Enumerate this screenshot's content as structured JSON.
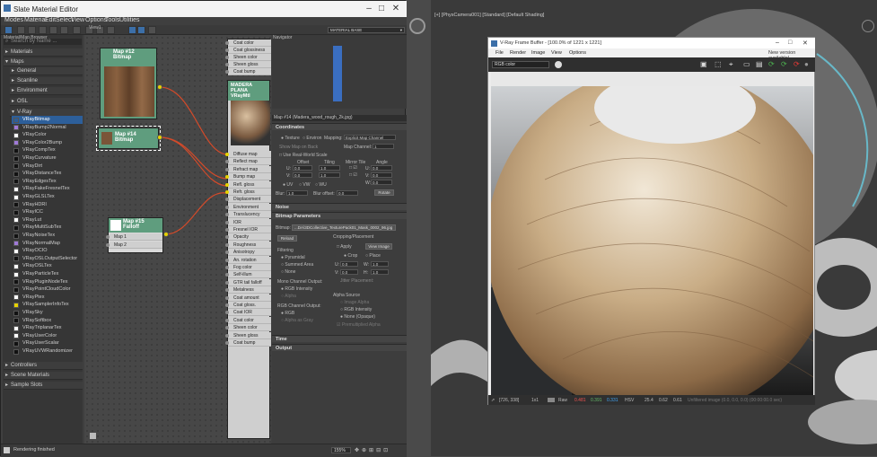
{
  "sme": {
    "title": "Slate Material Editor",
    "menu": [
      "Modes",
      "Material",
      "Edit",
      "Select",
      "View",
      "Options",
      "Tools",
      "Utilities"
    ],
    "browser_label": "Material/Map Browser",
    "search_placeholder": "Search by Name ...",
    "categories": {
      "materials": "Materials",
      "maps": "Maps",
      "general": "General",
      "scanline": "Scanline",
      "environment": "Environment",
      "osl": "OSL",
      "vray": "V-Ray",
      "controllers": "Controllers",
      "scene_materials": "Scene Materials",
      "sample_slots": "Sample Slots"
    },
    "vray_maps": [
      "VRayBitmap",
      "VRayBump2Normal",
      "VRayColor",
      "VRayColor2Bump",
      "VRayCompTex",
      "VRayCurvature",
      "VRayDirt",
      "VRayDistanceTex",
      "VRayEdgesTex",
      "VRayFakeFresnelTex",
      "VRayGLSLTex",
      "VRayHDRI",
      "VRayICC",
      "VRayLut",
      "VRayMultiSubTex",
      "VRayNoiseTex",
      "VRayNormalMap",
      "VRayOCIO",
      "VRayOSLOutputSelector",
      "VRayOSLTex",
      "VRayParticleTex",
      "VRayPluginNodeTex",
      "VRayPointCloudColor",
      "VRayPtex",
      "VRaySamplerInfoTex",
      "VRaySky",
      "VRaySoftbox",
      "VRayTriplanarTex",
      "VRayUserColor",
      "VRayUserScalar",
      "VRayUVWRandomizer"
    ],
    "view_label": "View1",
    "navigator_label": "Navigator",
    "material_dropdown": "MATERIAL BASE",
    "nodes": {
      "map12": {
        "name": "Map #12",
        "type": "Bitmap"
      },
      "map14": {
        "name": "Map #14",
        "type": "Bitmap"
      },
      "map15": {
        "name": "Map #15",
        "type": "Falloff",
        "slots": [
          "Map 1",
          "Map 2"
        ]
      },
      "material": {
        "name": "MADERA PLANA",
        "type": "VRayMtl",
        "slots_top": [
          "Coat color",
          "Coat glossiness",
          "Sheen color",
          "Sheen gloss",
          "Coat bump"
        ],
        "slots": [
          "Diffuse map",
          "Reflect map",
          "Refract map",
          "Bump map",
          "Refl. gloss",
          "Refr. gloss",
          "Displacement",
          "Environment",
          "Translucency",
          "IOR",
          "Fresnel IOR",
          "Opacity",
          "Roughness",
          "Anisotropy",
          "An. rotation",
          "Fog color",
          "Self-illum",
          "GTR tail falloff",
          "Metalness",
          "Coat amount",
          "Coat gloss.",
          "Coat IOR",
          "Coat color",
          "Sheen color",
          "Sheen gloss",
          "Coat bump"
        ]
      }
    },
    "param_title": "Map #14 (Madera_wood_rough_2k.jpg)",
    "rollouts": {
      "coordinates": "Coordinates",
      "noise": "Noise",
      "bitmap_params": "Bitmap Parameters",
      "time": "Time",
      "output": "Output"
    },
    "coords": {
      "texture": "Texture",
      "environ": "Environ",
      "mapping_label": "Mapping:",
      "mapping_value": "Explicit Map Channel",
      "show_map": "Show Map on Back",
      "map_channel_label": "Map Channel:",
      "map_channel": "1",
      "real_world": "Use Real-World Scale",
      "offset": "Offset",
      "tiling": "Tiling",
      "mirror_tile": "Mirror Tile",
      "angle": "Angle",
      "u_label": "U:",
      "v_label": "V:",
      "w_label": "W:",
      "u_offset": "0.0",
      "v_offset": "0.0",
      "u_tiling": "1.0",
      "v_tiling": "1.0",
      "u_angle": "0.0",
      "v_angle": "0.0",
      "w_angle": "0.0",
      "uv": "UV",
      "vw": "VW",
      "wu": "WU",
      "blur_label": "Blur:",
      "blur": "1.0",
      "blur_offset_label": "Blur offset:",
      "blur_offset": "0.0",
      "rotate": "Rotate"
    },
    "bitmap": {
      "label": "Bitmap:",
      "path": "...DA\\3DCollective_TexturePack01_Mask_0002_96.jpg",
      "reload": "Reload",
      "cropping": "Cropping/Placement",
      "apply": "Apply",
      "view_image": "View Image",
      "crop": "Crop",
      "place": "Place",
      "filtering": "Filtering",
      "pyramidal": "Pyramidal",
      "summed_area": "Summed Area",
      "none": "None",
      "u": "U:",
      "u_val": "0.0",
      "v": "V:",
      "v_val": "0.0",
      "w": "W:",
      "w_val": "1.0",
      "h": "H:",
      "h_val": "1.0",
      "jitter": "Jitter Placement:",
      "mono_output": "Mono Channel Output:",
      "rgb_intensity": "RGB Intensity",
      "alpha": "Alpha",
      "rgb_channel_output": "RGB Channel Output:",
      "rgb": "RGB",
      "alpha_as_gray": "Alpha as Gray",
      "alpha_source": "Alpha Source",
      "image_alpha": "Image Alpha",
      "rgb_int": "RGB Intensity",
      "none_opaque": "None (Opaque)",
      "premult": "Premultiplied Alpha"
    },
    "status_text": "Rendering finished",
    "zoom": "155%"
  },
  "viewport": {
    "label": "[+] [PhysCamera001] [Standard] [Default Shading]"
  },
  "vfb": {
    "title": "V-Ray Frame Buffer - [100.0% of 1221 x 1221]",
    "menu": [
      "File",
      "Render",
      "Image",
      "View",
      "Options"
    ],
    "new_version": "New version available!",
    "channel": "RGB color",
    "coords": "[726, 338]",
    "zoom": "1x1",
    "raw": "Raw",
    "r_val": "0.481",
    "g_val": "0.391",
    "b_val": "0.331",
    "mode": "HSV",
    "h_val": "25.4",
    "s_val": "0.62",
    "v_val": "0.61",
    "info": "Unfiltered image (0.0, 0.0, 0.0) (00:00:00.0 sec)"
  },
  "colors": {
    "selected": "#2d5f9a",
    "node_yellow": "#e6d200",
    "wire_red": "#d24a2a",
    "header_green": "#3d9a66"
  }
}
